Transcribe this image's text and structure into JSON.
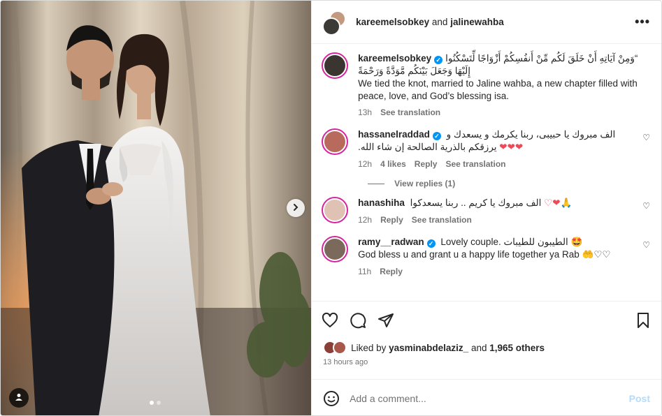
{
  "post": {
    "header": {
      "author": "kareemelsobkey",
      "connector": "and",
      "collaborator": "jalinewahba",
      "more_label": "•••"
    },
    "caption": {
      "username": "kareemelsobkey",
      "arabic": "“وَمِنْ آيَاتِهِ أَنْ خَلَقَ لَكُم مِّنْ أَنفُسِكُمْ أَزْوَاجًا لِّتَسْكُنُوا إِلَيْهَا وَجَعَلَ بَيْنَكُم مَّوَدَّةً وَرَحْمَةً",
      "english": "We tied the knot, married to Jaline wahba, a new chapter filled with peace, love, and God’s blessing isa.",
      "time": "13h",
      "translate": "See translation"
    },
    "comments": [
      {
        "username": "hassanelraddad",
        "verified": true,
        "line1": "الف مبروك يا حبيبى، ربنا يكرمك و يسعدك و",
        "line2": "يرزقكم بالذرية الصالحة إن شاء الله.",
        "hearts": "❤❤❤",
        "time": "12h",
        "likes": "4 likes",
        "reply": "Reply",
        "translate": "See translation",
        "view_replies": "View replies (1)"
      },
      {
        "username": "hanashiha",
        "verified": false,
        "text": "الف مبروك يا كريم .. ربنا يسعدكوا",
        "emoji": "♡❤🙏",
        "time": "12h",
        "reply": "Reply",
        "translate": "See translation"
      },
      {
        "username": "ramy__radwan",
        "verified": true,
        "text1": "Lovely couple. الطيبون للطيبات 🤩",
        "text2": "God bless u and grant u a happy life together ya Rab 🤲♡♡",
        "time": "11h",
        "reply": "Reply"
      }
    ],
    "likes": {
      "prefix": "Liked by",
      "user": "yasminabdelaziz_",
      "connector": "and",
      "others": "1,965 others"
    },
    "timestamp": "13 hours ago",
    "add_comment": {
      "placeholder": "Add a comment...",
      "post_label": "Post"
    },
    "carousel": {
      "slide_count": 2,
      "active_slide": 1
    }
  },
  "colors": {
    "verified": "#0095f6",
    "heart_red": "#ed4956",
    "muted": "#737373",
    "post_disabled": "#b3dbff"
  },
  "icons": [
    "heart-icon",
    "comment-icon",
    "share-icon",
    "bookmark-icon",
    "emoji-icon",
    "chevron-right-icon",
    "user-tag-icon",
    "more-icon"
  ]
}
